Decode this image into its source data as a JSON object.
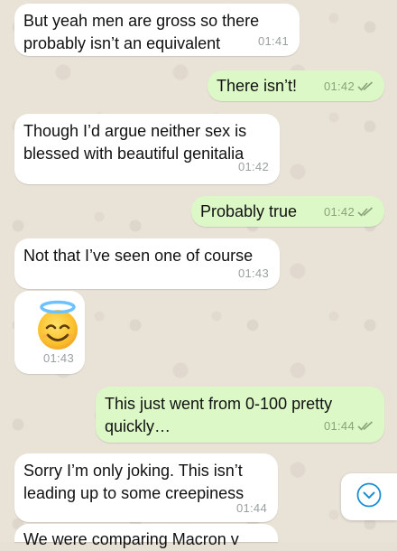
{
  "messages": [
    {
      "id": "m1",
      "direction": "incoming",
      "text": "But yeah men are gross so there\nprobably isn’t an equivalent",
      "time": "01:41"
    },
    {
      "id": "m2",
      "direction": "outgoing",
      "text": "There isn’t!",
      "time": "01:42",
      "status": "read"
    },
    {
      "id": "m3",
      "direction": "incoming",
      "text": "Though I’d argue neither sex is\nblessed with beautiful genitalia",
      "time": "01:42"
    },
    {
      "id": "m4",
      "direction": "outgoing",
      "text": "Probably true",
      "time": "01:42",
      "status": "read"
    },
    {
      "id": "m5",
      "direction": "incoming",
      "text": "Not that I’ve seen one of course",
      "time": "01:43"
    },
    {
      "id": "m6",
      "direction": "incoming",
      "emoji": "smiling-face-with-halo",
      "time": "01:43"
    },
    {
      "id": "m7",
      "direction": "outgoing",
      "text": "This just went from 0-100 pretty\nquickly…",
      "time": "01:44",
      "status": "read"
    },
    {
      "id": "m8",
      "direction": "incoming",
      "text": "Sorry I’m only joking. This isn’t\nleading up to some creepiness",
      "time": "01:44"
    },
    {
      "id": "m9",
      "direction": "incoming",
      "text": "We were comparing Macron v"
    }
  ],
  "scroll_button": {
    "icon": "chevron-down-circle-icon"
  },
  "colors": {
    "wallpaper": "#e9e2d7",
    "incoming_bubble": "#ffffff",
    "outgoing_bubble": "#dcf8c6",
    "time_text": "#9aa0a0",
    "read_tick": "#8aa27a",
    "scroll_icon": "#1a8fd6"
  }
}
